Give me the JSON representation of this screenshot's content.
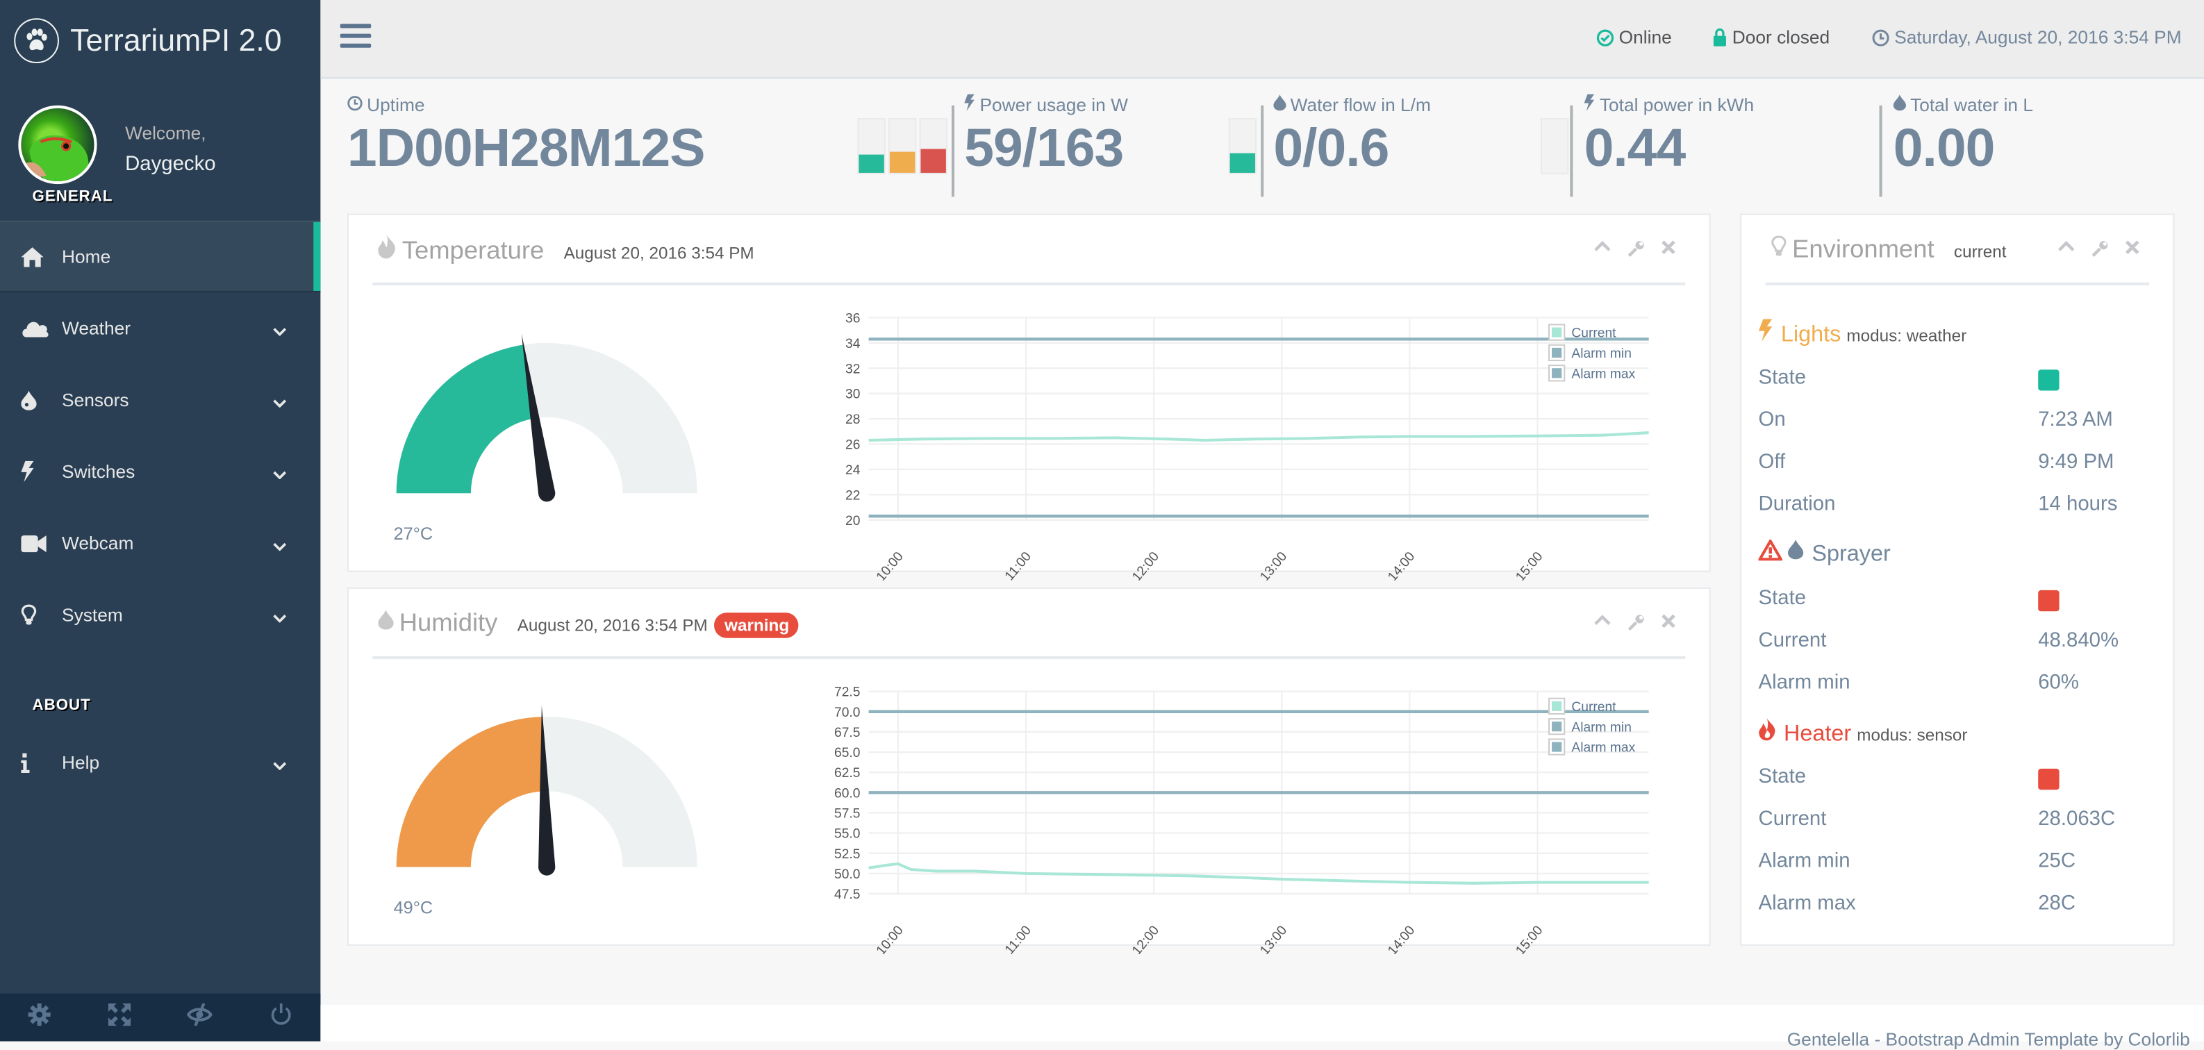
{
  "app": {
    "title": "TerrariumPI 2.0"
  },
  "profile": {
    "welcome": "Welcome,",
    "name": "Daygecko"
  },
  "sidebar": {
    "general_title": "GENERAL",
    "about_title": "ABOUT",
    "items": [
      {
        "label": "Home",
        "icon": "home-icon",
        "active": true
      },
      {
        "label": "Weather",
        "icon": "cloud-icon"
      },
      {
        "label": "Sensors",
        "icon": "tint-icon"
      },
      {
        "label": "Switches",
        "icon": "bolt-icon"
      },
      {
        "label": "Webcam",
        "icon": "video-camera-icon"
      },
      {
        "label": "System",
        "icon": "lightbulb-icon"
      }
    ],
    "help": {
      "label": "Help",
      "icon": "info-icon"
    },
    "footer_icons": [
      "gear-icon",
      "fullscreen-icon",
      "eye-slash-icon",
      "power-icon"
    ]
  },
  "topnav": {
    "status": "Online",
    "door": "Door closed",
    "datetime": "Saturday, August 20, 2016 3:54 PM"
  },
  "tiles": [
    {
      "label": "Uptime",
      "icon": "clock-icon",
      "value": "1D00H28M12S"
    },
    {
      "label": "Power usage in W",
      "icon": "bolt-icon",
      "value": "59/163"
    },
    {
      "label": "Water flow in L/m",
      "icon": "tint-icon",
      "value": "0/0.6"
    },
    {
      "label": "Total power in kWh",
      "icon": "bolt-icon",
      "value": "0.44"
    },
    {
      "label": "Total water in L",
      "icon": "tint-icon",
      "value": "0.00"
    }
  ],
  "power_bars": [
    {
      "fill": 0.35,
      "color": "#26B99A"
    },
    {
      "fill": 0.4,
      "color": "#F0AD4E"
    },
    {
      "fill": 0.44,
      "color": "#D9534F"
    }
  ],
  "water_bar": {
    "fill": 0.36,
    "color": "#26B99A"
  },
  "total_power_bar": {
    "fill": 0.0
  },
  "colors": {
    "accent": "#1ABB9C",
    "warning": "#F0AD4E",
    "danger": "#E74C3C",
    "text": "#73879C",
    "sidebar": "#2A3F54"
  },
  "temperature": {
    "title": "Temperature",
    "timestamp": "August 20, 2016 3:54 PM",
    "gauge_label": "27°C",
    "gauge_fraction": 0.45,
    "gauge_color": "#26B99A"
  },
  "humidity": {
    "title": "Humidity",
    "timestamp": "August 20, 2016 3:54 PM",
    "badge": "warning",
    "gauge_label": "49°C",
    "gauge_fraction": 0.49,
    "gauge_color": "#EF9A4A"
  },
  "chart_data": [
    {
      "type": "line",
      "title": "Temperature",
      "x": [
        "10:00",
        "11:00",
        "12:00",
        "13:00",
        "14:00",
        "15:00"
      ],
      "ylim": [
        20,
        36
      ],
      "yticks": [
        20,
        22,
        24,
        26,
        28,
        30,
        32,
        34,
        36
      ],
      "xrange": [
        9.77,
        15.87
      ],
      "legend": [
        "Current",
        "Alarm min",
        "Alarm max"
      ],
      "legend_position": "top-right",
      "grid": true,
      "series": [
        {
          "name": "Current",
          "color": "#A8E6D6",
          "points": [
            [
              9.77,
              26.3
            ],
            [
              10.2,
              26.4
            ],
            [
              10.7,
              26.45
            ],
            [
              11.2,
              26.45
            ],
            [
              11.7,
              26.5
            ],
            [
              12.1,
              26.4
            ],
            [
              12.4,
              26.3
            ],
            [
              12.8,
              26.4
            ],
            [
              13.2,
              26.45
            ],
            [
              13.6,
              26.55
            ],
            [
              14.0,
              26.6
            ],
            [
              14.5,
              26.6
            ],
            [
              15.0,
              26.65
            ],
            [
              15.5,
              26.7
            ],
            [
              15.6,
              26.75
            ],
            [
              15.87,
              26.9
            ]
          ]
        },
        {
          "name": "Alarm min",
          "color": "#8FB3BE",
          "value": 20.3
        },
        {
          "name": "Alarm max",
          "color": "#8FB3BE",
          "value": 34.3
        }
      ]
    },
    {
      "type": "line",
      "title": "Humidity",
      "x": [
        "10:00",
        "11:00",
        "12:00",
        "13:00",
        "14:00",
        "15:00"
      ],
      "ylim": [
        47.5,
        72.5
      ],
      "yticks": [
        47.5,
        50.0,
        52.5,
        55.0,
        57.5,
        60.0,
        62.5,
        65.0,
        67.5,
        70.0,
        72.5
      ],
      "xrange": [
        9.77,
        15.87
      ],
      "legend": [
        "Current",
        "Alarm min",
        "Alarm max"
      ],
      "legend_position": "top-right",
      "grid": true,
      "series": [
        {
          "name": "Current",
          "color": "#A8E6D6",
          "points": [
            [
              9.77,
              50.7
            ],
            [
              9.9,
              51.0
            ],
            [
              10.0,
              51.2
            ],
            [
              10.1,
              50.5
            ],
            [
              10.3,
              50.3
            ],
            [
              10.6,
              50.3
            ],
            [
              11.0,
              50.0
            ],
            [
              11.5,
              49.9
            ],
            [
              12.0,
              49.8
            ],
            [
              12.3,
              49.7
            ],
            [
              12.7,
              49.5
            ],
            [
              13.0,
              49.3
            ],
            [
              13.5,
              49.1
            ],
            [
              14.0,
              48.9
            ],
            [
              14.5,
              48.8
            ],
            [
              15.0,
              48.9
            ],
            [
              15.5,
              48.9
            ],
            [
              15.87,
              48.9
            ]
          ]
        },
        {
          "name": "Alarm min",
          "color": "#8FB3BE",
          "value": 60.0
        },
        {
          "name": "Alarm max",
          "color": "#8FB3BE",
          "value": 70.0
        }
      ]
    }
  ],
  "environment": {
    "title": "Environment",
    "subtitle": "current",
    "lights": {
      "title": "Lights",
      "modus": "modus: weather",
      "rows": [
        {
          "key": "State",
          "state_color": "#1ABB9C"
        },
        {
          "key": "On",
          "value": "7:23 AM"
        },
        {
          "key": "Off",
          "value": "9:49 PM"
        },
        {
          "key": "Duration",
          "value": "14 hours"
        }
      ]
    },
    "sprayer": {
      "title": "Sprayer",
      "rows": [
        {
          "key": "State",
          "state_color": "#E74C3C"
        },
        {
          "key": "Current",
          "value": "48.840%"
        },
        {
          "key": "Alarm min",
          "value": "60%"
        }
      ]
    },
    "heater": {
      "title": "Heater",
      "modus": "modus: sensor",
      "rows": [
        {
          "key": "State",
          "state_color": "#E74C3C"
        },
        {
          "key": "Current",
          "value": "28.063C"
        },
        {
          "key": "Alarm min",
          "value": "25C"
        },
        {
          "key": "Alarm max",
          "value": "28C"
        }
      ]
    }
  },
  "footer": {
    "text": "Gentelella - Bootstrap Admin Template by Colorlib"
  }
}
